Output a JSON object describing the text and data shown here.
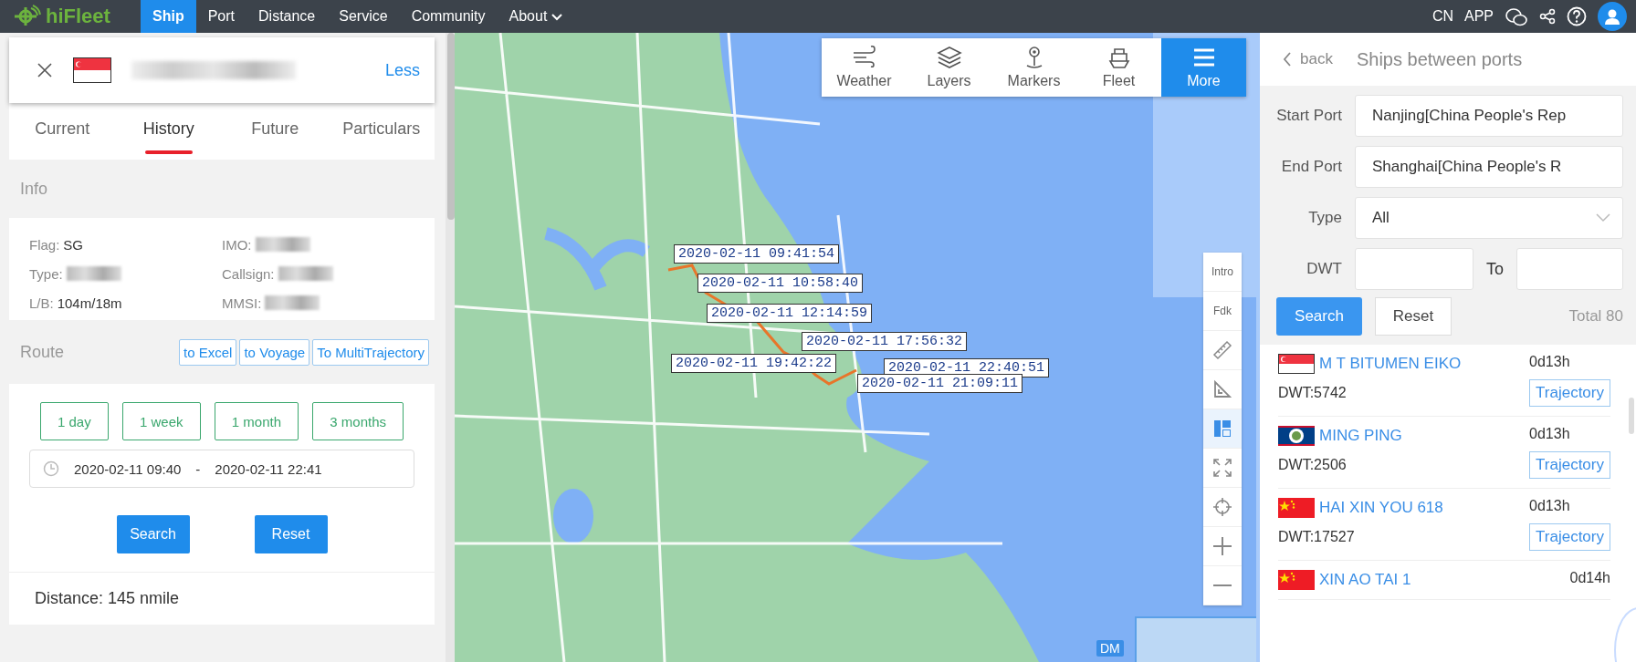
{
  "nav": {
    "logo": "hiFleet",
    "items": [
      {
        "label": "Ship",
        "selected": true,
        "dropdown": false
      },
      {
        "label": "Port",
        "selected": false,
        "dropdown": false
      },
      {
        "label": "Distance",
        "selected": false,
        "dropdown": false
      },
      {
        "label": "Service",
        "selected": false,
        "dropdown": false
      },
      {
        "label": "Community",
        "selected": false,
        "dropdown": false
      },
      {
        "label": "About",
        "selected": false,
        "dropdown": true
      }
    ],
    "right_items": [
      "CN",
      "APP"
    ]
  },
  "ship_header": {
    "kind": "sg",
    "action": "Less"
  },
  "ship_tabs": [
    {
      "label": "Current",
      "selected": false
    },
    {
      "label": "History",
      "selected": true
    },
    {
      "label": "Future",
      "selected": false
    },
    {
      "label": "Particulars",
      "selected": false
    }
  ],
  "info": {
    "title": "Info",
    "fields": [
      {
        "label": "Flag:",
        "value": "SG",
        "blurred": false
      },
      {
        "label": "IMO:",
        "blurred": true
      },
      {
        "label": "Type:",
        "blurred": true
      },
      {
        "label": "Callsign:",
        "blurred": true
      },
      {
        "label": "L/B:",
        "value": "104m/18m",
        "blurred": false
      },
      {
        "label": "MMSI:",
        "blurred": true
      }
    ]
  },
  "route": {
    "title": "Route",
    "exports": [
      "to Excel",
      "to Voyage",
      "To MultiTrajectory"
    ],
    "periods": [
      "1 day",
      "1 week",
      "1 month",
      "3 months"
    ],
    "start": "2020-02-11 09:40",
    "separator": "-",
    "end": "2020-02-11 22:41",
    "buttons": [
      "Search",
      "Reset"
    ],
    "distance": "Distance: 145 nmile"
  },
  "map": {
    "toolbar": [
      {
        "label": "Weather",
        "kind": "weather",
        "selected": false
      },
      {
        "label": "Layers",
        "kind": "layers",
        "selected": false
      },
      {
        "label": "Markers",
        "kind": "marker",
        "selected": false
      },
      {
        "label": "Fleet",
        "kind": "ship",
        "selected": false
      },
      {
        "label": "More",
        "kind": "menu",
        "selected": true
      }
    ],
    "tools": [
      {
        "kind": "text",
        "label": "Intro",
        "active": false
      },
      {
        "kind": "text",
        "label": "Fdk",
        "active": false
      },
      {
        "kind": "ruler",
        "active": false
      },
      {
        "kind": "triangle",
        "active": false
      },
      {
        "kind": "layout",
        "active": true
      },
      {
        "kind": "expand",
        "active": false
      },
      {
        "kind": "locate",
        "active": false
      },
      {
        "kind": "zoom-in",
        "active": false
      },
      {
        "kind": "zoom-out",
        "active": false
      }
    ],
    "track_labels": [
      "2020-02-11 09:41:54",
      "2020-02-11 10:58:40",
      "2020-02-11 12:14:59",
      "2020-02-11 17:56:32",
      "2020-02-11 19:42:22",
      "2020-02-11 22:40:51",
      "2020-02-11 21:09:11"
    ],
    "badge": "DM"
  },
  "ports": {
    "back": "back",
    "title": "Ships between ports",
    "fields": [
      {
        "label": "Start Port",
        "value": "Nanjing[China People's Rep",
        "kind": "text"
      },
      {
        "label": "End Port",
        "value": "Shanghai[China People's R",
        "kind": "text"
      },
      {
        "label": "Type",
        "value": "All",
        "kind": "select"
      }
    ],
    "dwt_label": "DWT",
    "dwt_to": "To",
    "search": "Search",
    "reset": "Reset",
    "total": "Total 80",
    "ships": [
      {
        "kind": "sg",
        "name": "M T BITUMEN EIKO",
        "time": "0d13h",
        "dwt": "DWT:5742",
        "action": "Trajectory"
      },
      {
        "kind": "bz",
        "name": "MING PING",
        "time": "0d13h",
        "dwt": "DWT:2506",
        "action": "Trajectory"
      },
      {
        "kind": "cn",
        "name": "HAI XIN YOU 618",
        "time": "0d13h",
        "dwt": "DWT:17527",
        "action": "Trajectory"
      },
      {
        "kind": "cn",
        "name": "XIN AO TAI 1",
        "time": "0d14h"
      }
    ]
  }
}
